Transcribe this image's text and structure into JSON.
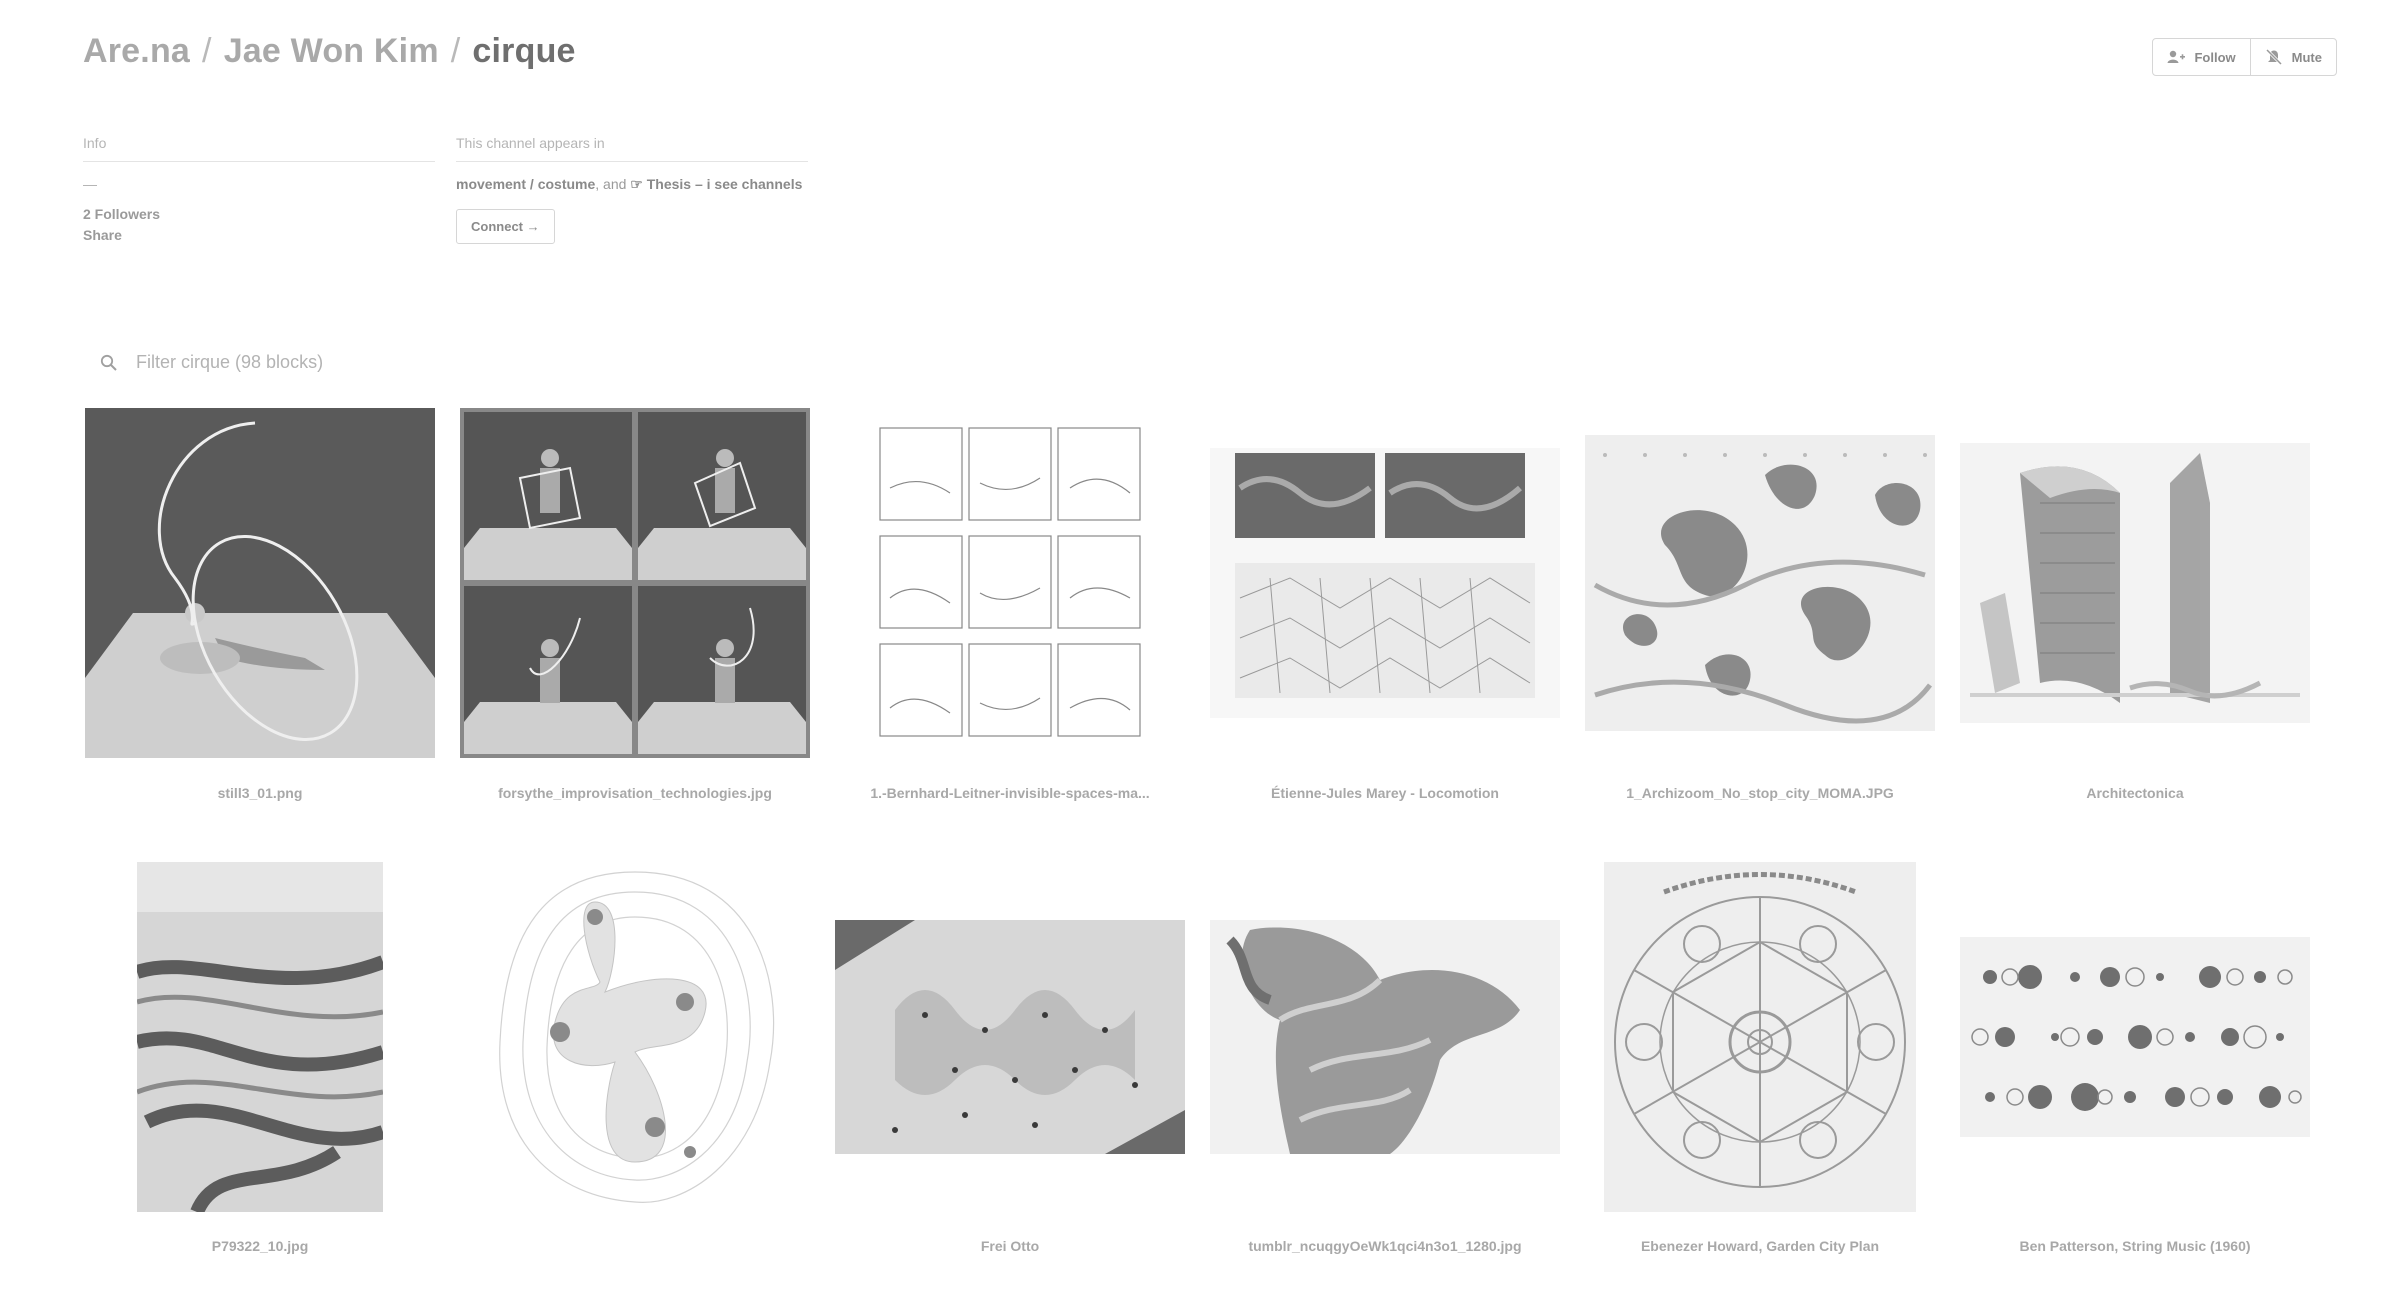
{
  "breadcrumb": {
    "root": "Are.na",
    "user": "Jae Won Kim",
    "channel": "cirque",
    "separator": "/"
  },
  "actions": {
    "follow_label": "Follow",
    "mute_label": "Mute"
  },
  "info": {
    "heading": "Info",
    "description": "—",
    "followers": "2 Followers",
    "share": "Share"
  },
  "appears_in": {
    "heading": "This channel appears in",
    "channel_1": "movement / costume",
    "joiner": ", and ",
    "channel_2": "☞ Thesis – i see channels",
    "connect_label": "Connect →"
  },
  "filter": {
    "placeholder": "Filter cirque (98 blocks)"
  },
  "blocks": [
    {
      "title": "still3_01.png",
      "icon": "figure-with-ribbon"
    },
    {
      "title": "forsythe_improvisation_technologies.jpg",
      "icon": "four-panel-dancer"
    },
    {
      "title": "1.-Bernhard-Leitner-invisible-spaces-ma...",
      "icon": "grid-room-diagrams"
    },
    {
      "title": "Étienne-Jules Marey - Locomotion",
      "icon": "motion-study"
    },
    {
      "title": "1_Archizoom_No_stop_city_MOMA.JPG",
      "icon": "blob-plan"
    },
    {
      "title": "Architectonica",
      "icon": "building-render"
    },
    {
      "title": "P79322_10.jpg",
      "icon": "aerial-photo"
    },
    {
      "title": "",
      "icon": "contour-diagram"
    },
    {
      "title": "Frei Otto",
      "icon": "membrane-model"
    },
    {
      "title": "tumblr_ncuqgyOeWk1qci4n3o1_1280.jpg",
      "icon": "cloth-figure"
    },
    {
      "title": "Ebenezer Howard, Garden City Plan",
      "icon": "garden-city-plan"
    },
    {
      "title": "Ben Patterson, String Music (1960)",
      "icon": "circle-score"
    }
  ]
}
